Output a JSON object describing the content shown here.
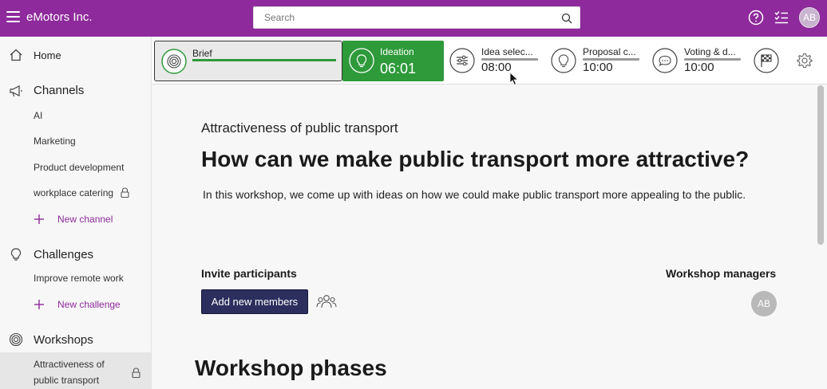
{
  "app": {
    "title": "eMotors Inc."
  },
  "search": {
    "placeholder": "Search"
  },
  "user": {
    "initials": "AB"
  },
  "sidebar": {
    "home": "Home",
    "channels_heading": "Channels",
    "channels": [
      "AI",
      "Marketing",
      "Product development",
      "workplace catering"
    ],
    "new_channel": "New channel",
    "challenges_heading": "Challenges",
    "challenges": [
      "Improve remote work"
    ],
    "new_challenge": "New challenge",
    "workshops_heading": "Workshops",
    "workshop_selected_line1": "Attractiveness of",
    "workshop_selected_line2": "public transport"
  },
  "phases": [
    {
      "name": "Brief",
      "time": "",
      "state": "done"
    },
    {
      "name": "Ideation",
      "time": "06:01",
      "state": "active"
    },
    {
      "name": "Idea selec...",
      "time": "08:00",
      "state": "upcoming"
    },
    {
      "name": "Proposal c...",
      "time": "10:00",
      "state": "upcoming"
    },
    {
      "name": "Voting & d...",
      "time": "10:00",
      "state": "upcoming"
    }
  ],
  "workshop": {
    "subtitle": "Attractiveness of public transport",
    "title": "How can we make public transport more attractive?",
    "description": "In this workshop, we come up with ideas on how we could make public transport more appealing to the public.",
    "invite_heading": "Invite participants",
    "add_members_label": "Add new members",
    "managers_heading": "Workshop managers",
    "manager_initials": "AB",
    "phases_heading": "Workshop phases"
  },
  "colors": {
    "brand": "#8e2a9c",
    "active_phase": "#2e9a3a",
    "primary_button": "#2c2e5e"
  }
}
